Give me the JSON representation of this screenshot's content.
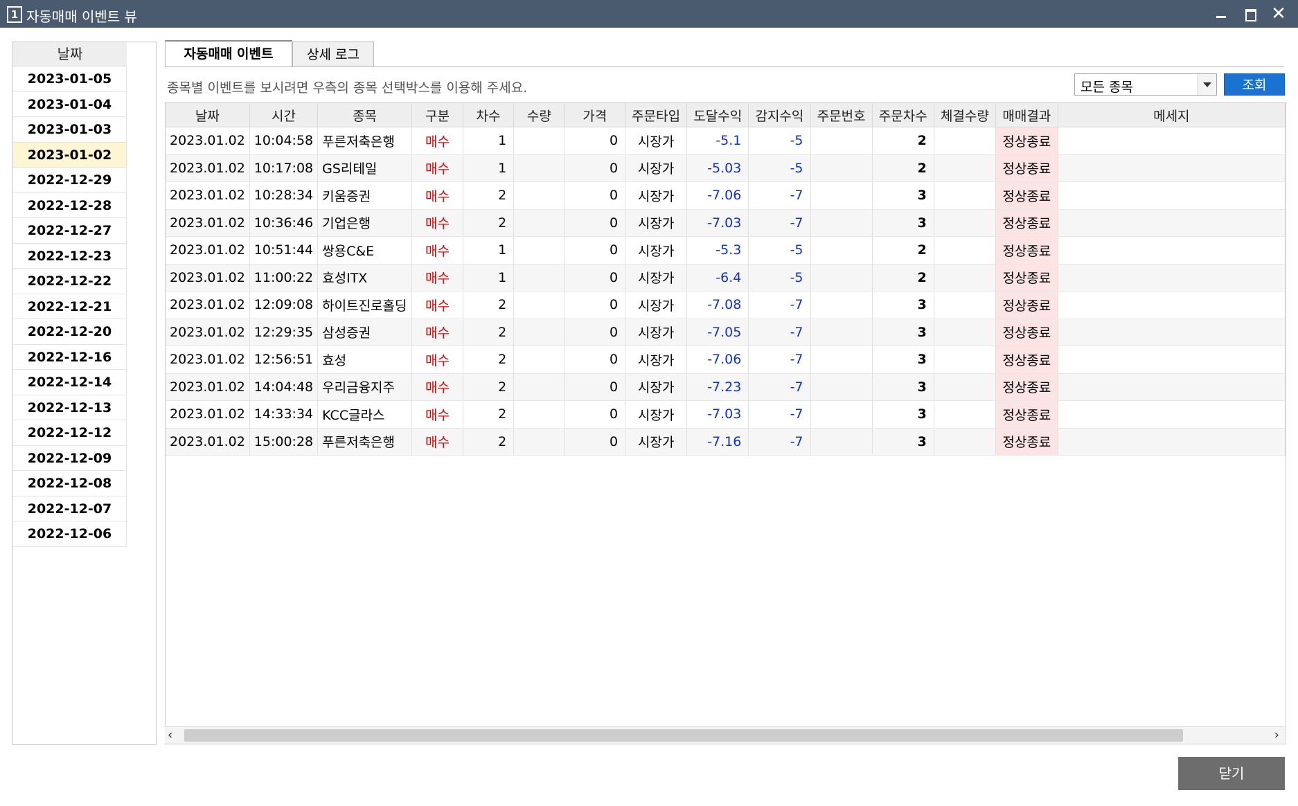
{
  "window": {
    "icon_label": "1",
    "title": "자동매매 이벤트 뷰"
  },
  "date_panel": {
    "header": "날짜",
    "dates": [
      "2023-01-05",
      "2023-01-04",
      "2023-01-03",
      "2023-01-02",
      "2022-12-29",
      "2022-12-28",
      "2022-12-27",
      "2022-12-23",
      "2022-12-22",
      "2022-12-21",
      "2022-12-20",
      "2022-12-16",
      "2022-12-14",
      "2022-12-13",
      "2022-12-12",
      "2022-12-09",
      "2022-12-08",
      "2022-12-07",
      "2022-12-06"
    ],
    "selected": "2023-01-02"
  },
  "tabs": [
    {
      "label": "자동매매 이벤트",
      "active": true
    },
    {
      "label": "상세 로그",
      "active": false
    }
  ],
  "hint": "종목별 이벤트를 보시려면 우측의 종목 선택박스를 이용해 주세요.",
  "stock_select": {
    "value": "모든 종목"
  },
  "search_button": "조회",
  "table": {
    "columns": [
      "날짜",
      "시간",
      "종목",
      "구분",
      "차수",
      "수량",
      "가격",
      "주문타입",
      "도달수익",
      "감지수익",
      "주문번호",
      "주문차수",
      "체결수량",
      "매매결과",
      "메세지"
    ],
    "rows": [
      [
        "2023.01.02",
        "10:04:58",
        "푸른저축은행",
        "매수",
        "1",
        "",
        "0",
        "시장가",
        "-5.1",
        "-5",
        "",
        "2",
        "",
        "정상종료",
        ""
      ],
      [
        "2023.01.02",
        "10:17:08",
        "GS리테일",
        "매수",
        "1",
        "",
        "0",
        "시장가",
        "-5.03",
        "-5",
        "",
        "2",
        "",
        "정상종료",
        ""
      ],
      [
        "2023.01.02",
        "10:28:34",
        "키움증권",
        "매수",
        "2",
        "",
        "0",
        "시장가",
        "-7.06",
        "-7",
        "",
        "3",
        "",
        "정상종료",
        ""
      ],
      [
        "2023.01.02",
        "10:36:46",
        "기업은행",
        "매수",
        "2",
        "",
        "0",
        "시장가",
        "-7.03",
        "-7",
        "",
        "3",
        "",
        "정상종료",
        ""
      ],
      [
        "2023.01.02",
        "10:51:44",
        "쌍용C&E",
        "매수",
        "1",
        "",
        "0",
        "시장가",
        "-5.3",
        "-5",
        "",
        "2",
        "",
        "정상종료",
        ""
      ],
      [
        "2023.01.02",
        "11:00:22",
        "효성ITX",
        "매수",
        "1",
        "",
        "0",
        "시장가",
        "-6.4",
        "-5",
        "",
        "2",
        "",
        "정상종료",
        ""
      ],
      [
        "2023.01.02",
        "12:09:08",
        "하이트진로홀딩",
        "매수",
        "2",
        "",
        "0",
        "시장가",
        "-7.08",
        "-7",
        "",
        "3",
        "",
        "정상종료",
        ""
      ],
      [
        "2023.01.02",
        "12:29:35",
        "삼성증권",
        "매수",
        "2",
        "",
        "0",
        "시장가",
        "-7.05",
        "-7",
        "",
        "3",
        "",
        "정상종료",
        ""
      ],
      [
        "2023.01.02",
        "12:56:51",
        "효성",
        "매수",
        "2",
        "",
        "0",
        "시장가",
        "-7.06",
        "-7",
        "",
        "3",
        "",
        "정상종료",
        ""
      ],
      [
        "2023.01.02",
        "14:04:48",
        "우리금융지주",
        "매수",
        "2",
        "",
        "0",
        "시장가",
        "-7.23",
        "-7",
        "",
        "3",
        "",
        "정상종료",
        ""
      ],
      [
        "2023.01.02",
        "14:33:34",
        "KCC글라스",
        "매수",
        "2",
        "",
        "0",
        "시장가",
        "-7.03",
        "-7",
        "",
        "3",
        "",
        "정상종료",
        ""
      ],
      [
        "2023.01.02",
        "15:00:28",
        "푸른저축은행",
        "매수",
        "2",
        "",
        "0",
        "시장가",
        "-7.16",
        "-7",
        "",
        "3",
        "",
        "정상종료",
        ""
      ]
    ]
  },
  "close_button": "닫기",
  "colors": {
    "titlebar": "#4a5a6f",
    "buy_text": "#e00000",
    "profit_text": "#1030d0",
    "result_bg": "#fde4e4",
    "selected_date_bg": "#fdf5d4",
    "search_button": "#1a73d0",
    "close_button": "#6d6d6d"
  }
}
